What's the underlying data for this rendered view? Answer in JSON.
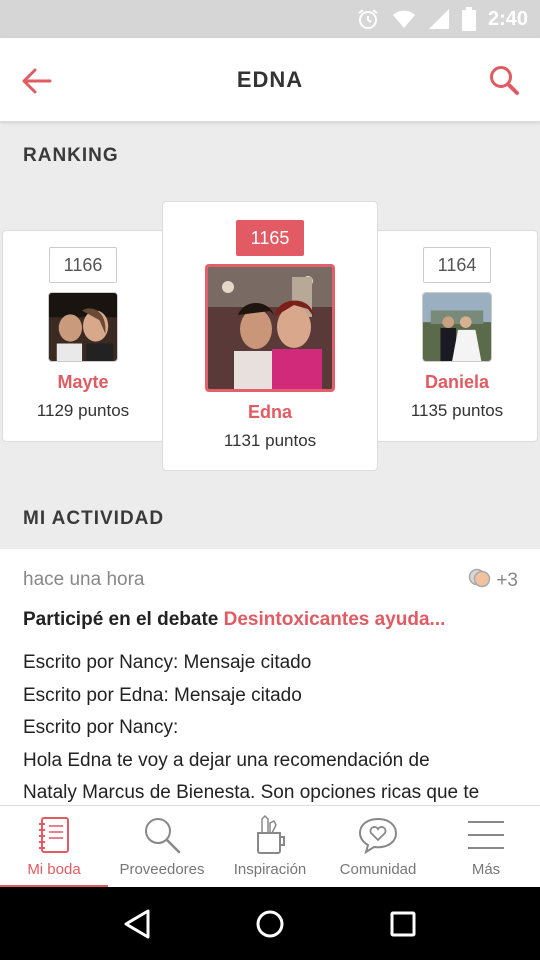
{
  "status_bar": {
    "time": "2:40"
  },
  "header": {
    "title": "EDNA"
  },
  "sections": {
    "ranking": "RANKING",
    "activity": "MI ACTIVIDAD"
  },
  "ranking": {
    "left": {
      "rank": "1166",
      "name": "Mayte",
      "points": "1129 puntos"
    },
    "center": {
      "rank": "1165",
      "name": "Edna",
      "points": "1131 puntos"
    },
    "right": {
      "rank": "1164",
      "name": "Daniela",
      "points": "1135 puntos"
    }
  },
  "activity": {
    "time": "hace una hora",
    "comment_count": "+3",
    "lead_prefix": "Participé en el debate",
    "lead_link": "Desintoxicantes ayuda...",
    "lines": [
      "Escrito por Nancy: Mensaje citado",
      "Escrito por Edna: Mensaje citado",
      "Escrito por Nancy:",
      "Hola Edna te voy a dejar una recomendación de",
      "Nataly Marcus de Bienesta. Son opciones ricas que te"
    ]
  },
  "bottom_nav": [
    {
      "label": "Mi boda",
      "icon": "notebook-icon",
      "active": true
    },
    {
      "label": "Proveedores",
      "icon": "search-icon",
      "active": false
    },
    {
      "label": "Inspiración",
      "icon": "pencil-cup-icon",
      "active": false
    },
    {
      "label": "Comunidad",
      "icon": "heart-chat-icon",
      "active": false
    },
    {
      "label": "Más",
      "icon": "menu-icon",
      "active": false
    }
  ],
  "colors": {
    "accent": "#e05b62",
    "status_bar": "#d6d6d6",
    "background": "#ececec"
  }
}
